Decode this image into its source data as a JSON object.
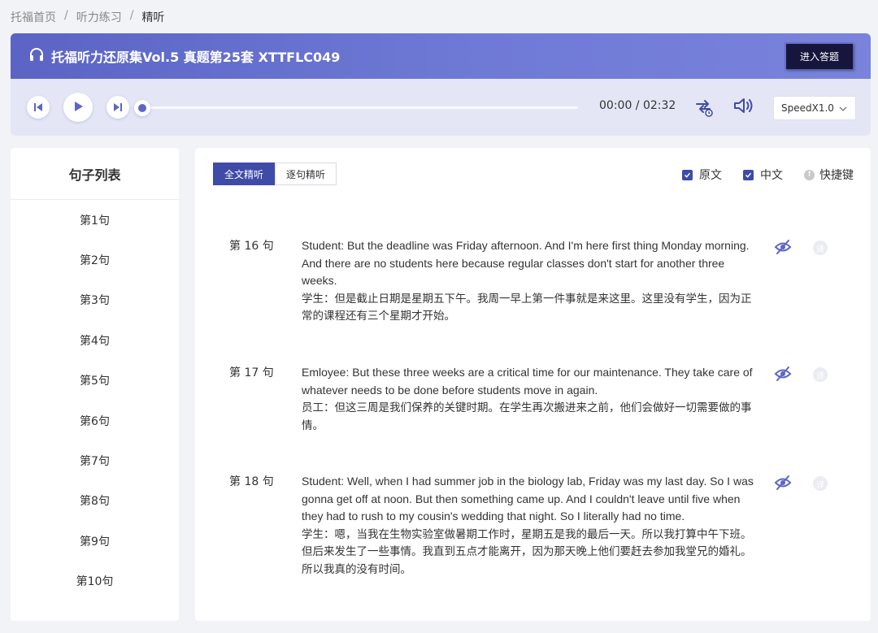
{
  "breadcrumb": {
    "items": [
      "托福首页",
      "听力练习",
      "精听"
    ],
    "separator": "/"
  },
  "header": {
    "title": "托福听力还原集Vol.5 真题第25套 XTTFLC049",
    "enter_button": "进入答题",
    "icon": "headphones-icon"
  },
  "player": {
    "time": "00:00 / 02:32",
    "progress": 0,
    "speed": "SpeedX1.0",
    "colors": {
      "accent": "#5c66c6"
    }
  },
  "sidebar": {
    "title": "句子列表",
    "items": [
      "第1句",
      "第2句",
      "第3句",
      "第4句",
      "第5句",
      "第6句",
      "第7句",
      "第8句",
      "第9句",
      "第10句"
    ]
  },
  "main": {
    "tabs": [
      {
        "label": "全文精听",
        "active": true
      },
      {
        "label": "逐句精听",
        "active": false
      }
    ],
    "options": {
      "original": "原文",
      "chinese": "中文",
      "shortcuts": "快捷键"
    },
    "sentences": [
      {
        "num": "第 16 句",
        "en": "Student: But the deadline was Friday afternoon. And I'm here first thing Monday morning. And there are no students here because regular classes don't start for another three weeks.",
        "cn": "学生：但是截止日期是星期五下午。我周一早上第一件事就是来这里。这里没有学生，因为正常的课程还有三个星期才开始。"
      },
      {
        "num": "第 17 句",
        "en": "Emloyee: But these three weeks are a critical time for our maintenance. They take care of whatever needs to be done before students move in again.",
        "cn": "员工：但这三周是我们保养的关键时期。在学生再次搬进来之前，他们会做好一切需要做的事情。"
      },
      {
        "num": "第 18 句",
        "en": "Student: Well, when I had summer job in the biology lab, Friday was my last day. So I was gonna get off at noon. But then something came up. And I couldn't leave until five when they had to rush to my cousin's wedding that night. So I literally had no time.",
        "cn": "学生：嗯，当我在生物实验室做暑期工作时，星期五是我的最后一天。所以我打算中午下班。但后来发生了一些事情。我直到五点才能离开，因为那天晚上他们要赶去参加我堂兄的婚礼。所以我真的没有时间。"
      }
    ]
  }
}
